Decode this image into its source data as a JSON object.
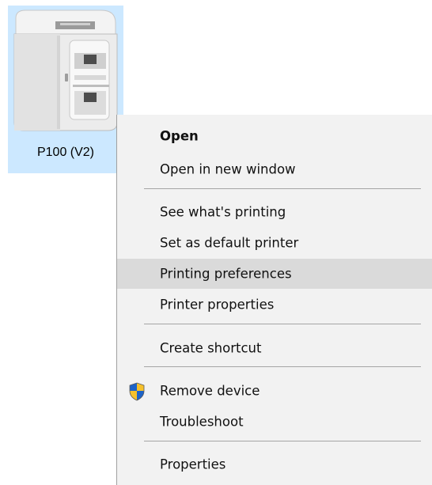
{
  "device": {
    "label": "P100 (V2)",
    "icon": "card-printer-icon"
  },
  "menu": {
    "items": [
      {
        "label": "Open",
        "bold": true
      },
      {
        "label": "Open in new window"
      },
      {
        "label": "See what's printing"
      },
      {
        "label": "Set as default printer"
      },
      {
        "label": "Printing preferences",
        "highlighted": true
      },
      {
        "label": "Printer properties"
      },
      {
        "label": "Create shortcut"
      },
      {
        "label": "Remove device",
        "icon": "uac-shield-icon"
      },
      {
        "label": "Troubleshoot"
      },
      {
        "label": "Properties"
      }
    ]
  },
  "colors": {
    "selection_tile": "#cce8ff",
    "menu_background": "#f2f2f2",
    "menu_highlight": "#dadada",
    "separator": "#a5a5a5"
  }
}
